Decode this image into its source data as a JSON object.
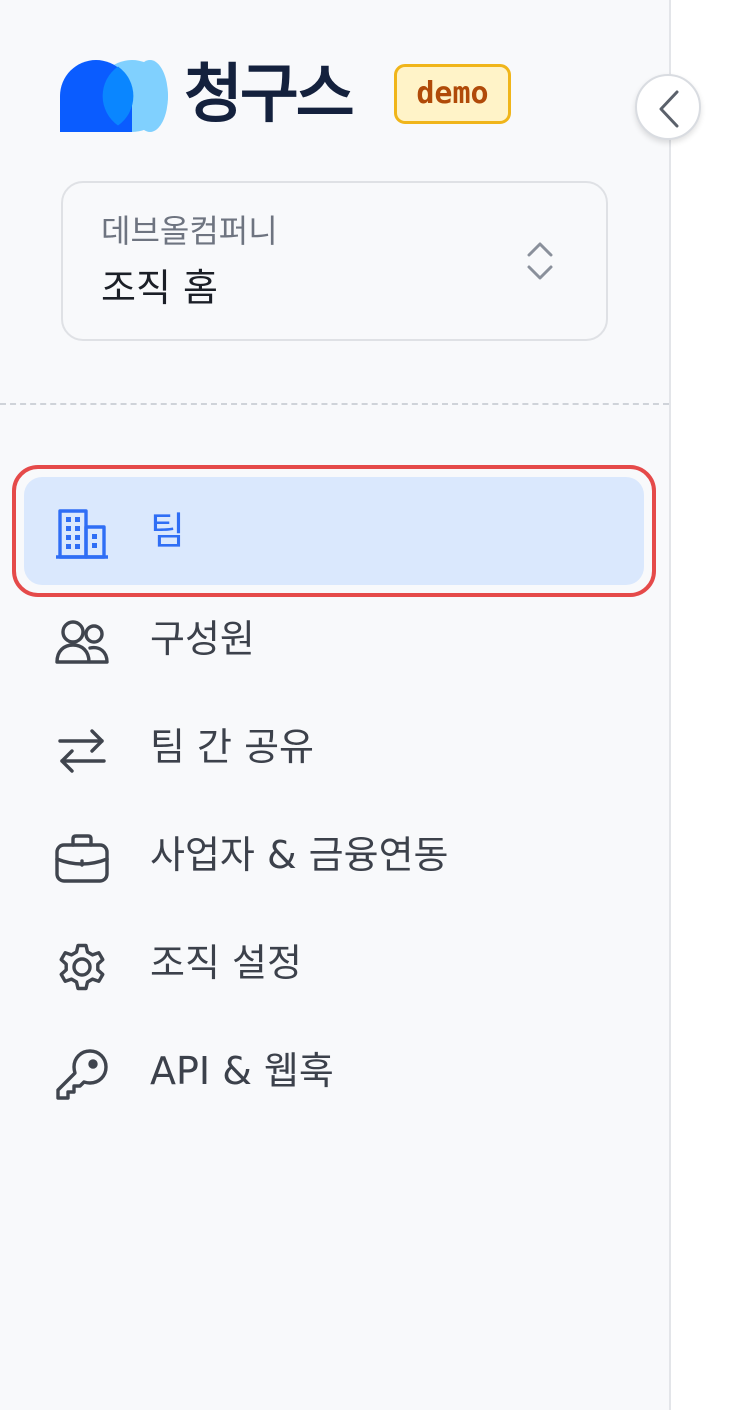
{
  "app": {
    "brand_name": "청구스",
    "badge": "demo"
  },
  "org_selector": {
    "org_name": "데브올컴퍼니",
    "current_page": "조직 홈"
  },
  "nav": {
    "items": [
      {
        "label": "팀",
        "icon": "building-icon",
        "active": true
      },
      {
        "label": "구성원",
        "icon": "users-icon",
        "active": false
      },
      {
        "label": "팀 간 공유",
        "icon": "arrows-swap-icon",
        "active": false
      },
      {
        "label": "사업자 & 금융연동",
        "icon": "briefcase-icon",
        "active": false
      },
      {
        "label": "조직 설정",
        "icon": "gear-icon",
        "active": false
      },
      {
        "label": "API & 웹훅",
        "icon": "key-icon",
        "active": false
      }
    ]
  },
  "colors": {
    "accent": "#2f6ef5",
    "active_bg": "#dae8fd",
    "highlight": "#e54a4a",
    "badge_border": "#f0b51a",
    "badge_bg": "#fff3c8",
    "badge_text": "#b04a09"
  }
}
